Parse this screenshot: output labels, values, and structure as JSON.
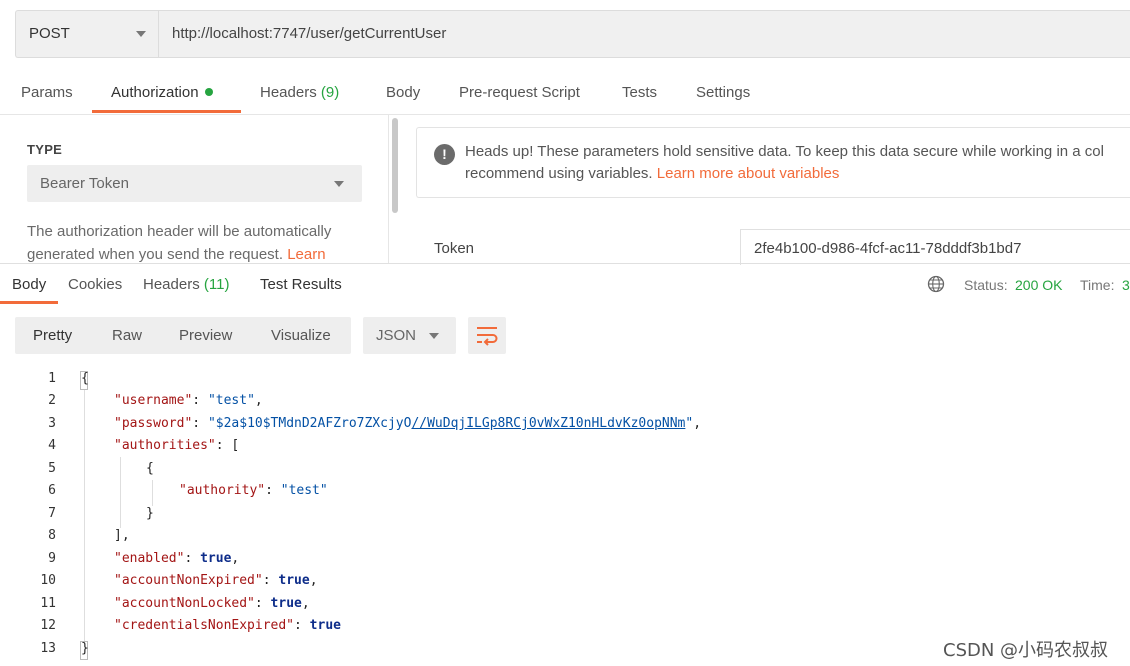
{
  "request": {
    "method": "POST",
    "url": "http://localhost:7747/user/getCurrentUser",
    "tabs": {
      "params": "Params",
      "authorization": "Authorization",
      "headers": "Headers",
      "headers_count": "(9)",
      "body": "Body",
      "prerequest": "Pre-request Script",
      "tests": "Tests",
      "settings": "Settings"
    }
  },
  "auth": {
    "type_label": "TYPE",
    "type_value": "Bearer Token",
    "description": "The authorization header will be automatically generated when you send the request.",
    "learn_link": "Learn",
    "headsup_line1": "Heads up! These parameters hold sensitive data. To keep this data secure while working in a col",
    "headsup_line2": "recommend using variables.",
    "headsup_link": "Learn more about variables",
    "token_label": "Token",
    "token_value": "2fe4b100-d986-4fcf-ac11-78dddf3b1bd7"
  },
  "response": {
    "tabs": {
      "body": "Body",
      "cookies": "Cookies",
      "headers": "Headers",
      "headers_count": "(11)",
      "test_results": "Test Results"
    },
    "status_label": "Status:",
    "status_value": "200 OK",
    "time_label": "Time:",
    "time_value": "3",
    "view_modes": {
      "pretty": "Pretty",
      "raw": "Raw",
      "preview": "Preview",
      "visualize": "Visualize"
    },
    "language": "JSON",
    "code_lines": [
      "{",
      "\"username\": \"test\",",
      "\"password\": \"$2a$10$TMdnD2AFZro7ZXcjyO//WuDqjILGp8RCj0vWxZ10nHLdvKz0opNNm\",",
      "\"authorities\": [",
      "{",
      "\"authority\": \"test\"",
      "}",
      "],",
      "\"enabled\": true,",
      "\"accountNonExpired\": true,",
      "\"accountNonLocked\": true,",
      "\"credentialsNonExpired\": true",
      "}"
    ],
    "line_numbers": [
      "1",
      "2",
      "3",
      "4",
      "5",
      "6",
      "7",
      "8",
      "9",
      "10",
      "11",
      "12",
      "13"
    ]
  },
  "watermark": "CSDN @小码农叔叔"
}
